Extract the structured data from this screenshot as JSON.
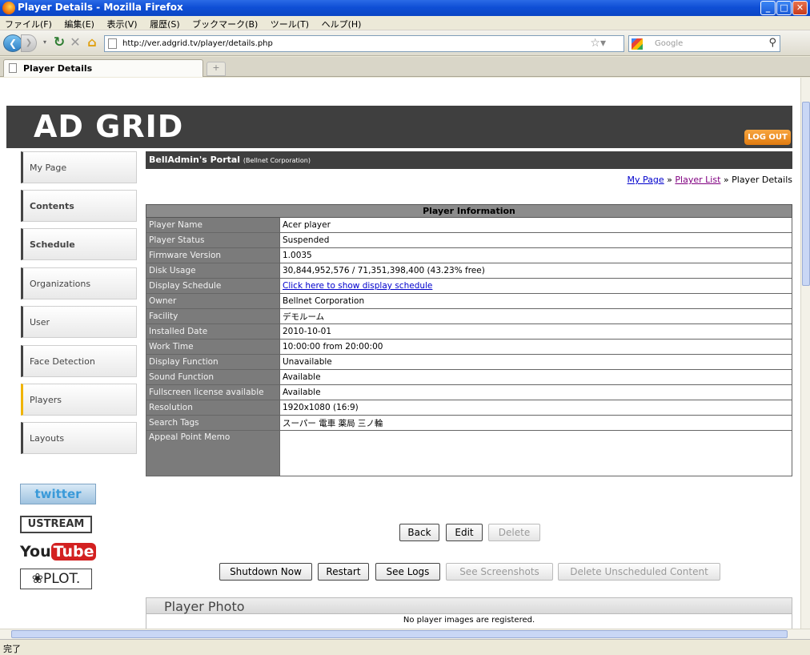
{
  "window": {
    "title": "Player Details - Mozilla Firefox"
  },
  "menu": [
    "ファイル(F)",
    "編集(E)",
    "表示(V)",
    "履歴(S)",
    "ブックマーク(B)",
    "ツール(T)",
    "ヘルプ(H)"
  ],
  "nav": {
    "url": "http://ver.adgrid.tv/player/details.php",
    "search_placeholder": "Google"
  },
  "tab": {
    "label": "Player Details"
  },
  "status": "完了",
  "site": {
    "logo": "AD GRID",
    "logout": "LOG OUT"
  },
  "sidebar": [
    {
      "label": "My Page"
    },
    {
      "label": "Contents"
    },
    {
      "label": "Schedule"
    },
    {
      "label": "Organizations"
    },
    {
      "label": "User"
    },
    {
      "label": "Face Detection"
    },
    {
      "label": "Players"
    },
    {
      "label": "Layouts"
    }
  ],
  "social": {
    "twitter": "twitter",
    "ustream": "USTREAM",
    "youtube_you": "You",
    "youtube_tube": "Tube",
    "plot": "PLOT."
  },
  "portal": {
    "title": "BellAdmin's Portal",
    "company": "(Bellnet Corporation)"
  },
  "breadcrumb": {
    "mypage": "My Page",
    "sep1": " » ",
    "playerlist": "Player List",
    "sep2": " » ",
    "current": "Player Details"
  },
  "info": {
    "header": "Player Information",
    "rows": [
      {
        "label": "Player Name",
        "value": "Acer player"
      },
      {
        "label": "Player Status",
        "value": "Suspended"
      },
      {
        "label": "Firmware Version",
        "value": "1.0035"
      },
      {
        "label": "Disk Usage",
        "value": "30,844,952,576 / 71,351,398,400 (43.23% free)"
      },
      {
        "label": "Display Schedule",
        "value": "Click here to show display schedule"
      },
      {
        "label": "Owner",
        "value": "Bellnet Corporation"
      },
      {
        "label": "Facility",
        "value": "デモルーム"
      },
      {
        "label": "Installed Date",
        "value": "2010-10-01"
      },
      {
        "label": "Work Time",
        "value": "10:00:00 from 20:00:00"
      },
      {
        "label": "Display Function",
        "value": "Unavailable"
      },
      {
        "label": "Sound Function",
        "value": "Available"
      },
      {
        "label": "Fullscreen license available",
        "value": "Available"
      },
      {
        "label": "Resolution",
        "value": "1920x1080 (16:9)"
      },
      {
        "label": "Search Tags",
        "value": "スーパー 電車 薬局 三ノ輪"
      },
      {
        "label": "Appeal Point Memo",
        "value": ""
      }
    ]
  },
  "buttons": {
    "back": "Back",
    "edit": "Edit",
    "delete": "Delete",
    "shutdown": "Shutdown Now",
    "restart": "Restart",
    "seelogs": "See Logs",
    "screenshots": "See Screenshots",
    "delete_unscheduled": "Delete Unscheduled Content"
  },
  "photo": {
    "title": "Player Photo",
    "empty": "No player images are registered."
  }
}
